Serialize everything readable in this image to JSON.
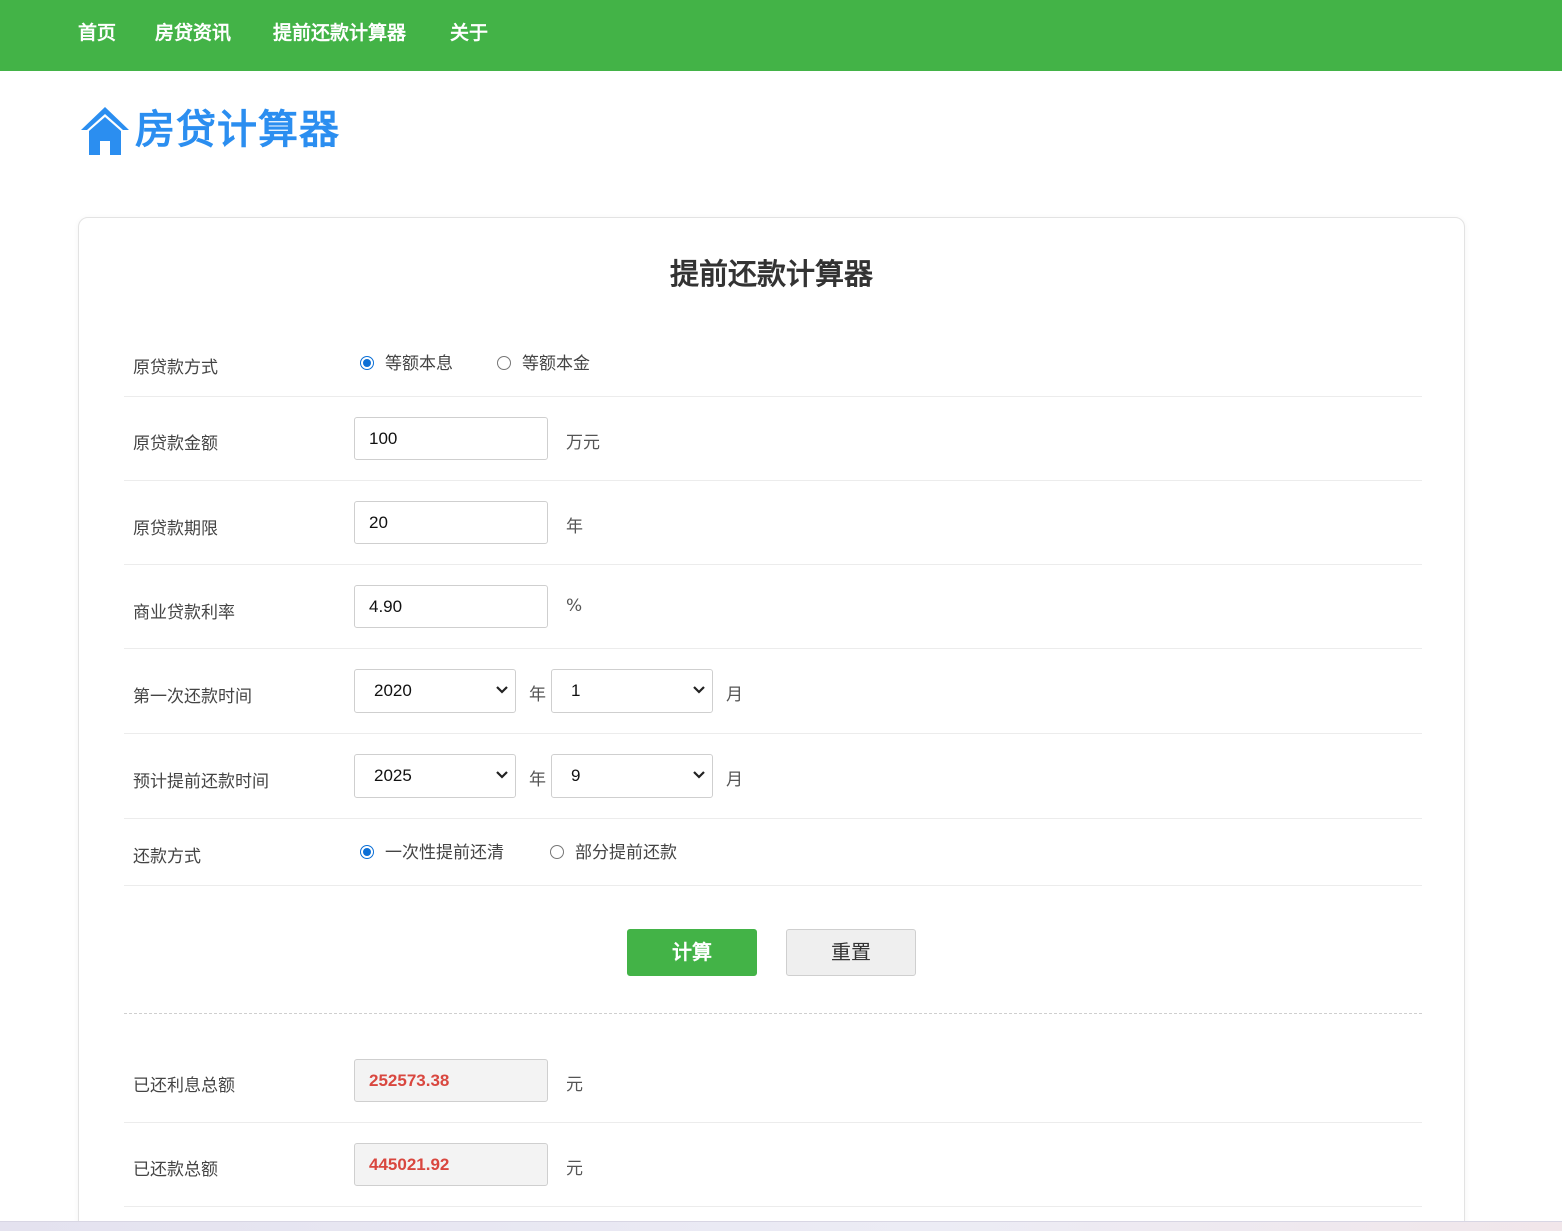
{
  "nav": {
    "items": [
      {
        "label": "首页"
      },
      {
        "label": "房贷资讯"
      },
      {
        "label": "提前还款计算器"
      },
      {
        "label": "关于"
      }
    ]
  },
  "logo": {
    "text": "房贷计算器",
    "icon": "house-icon",
    "color": "#2b8ef0"
  },
  "colors": {
    "nav_bg": "#43b347",
    "accent": "#43b347",
    "result_text": "#d9473f",
    "radio_checked": "#0b6fd6"
  },
  "form": {
    "title": "提前还款计算器",
    "loan_type": {
      "label": "原贷款方式",
      "options": [
        "等额本息",
        "等额本金"
      ],
      "selected": "等额本息"
    },
    "loan_amount": {
      "label": "原贷款金额",
      "value": "100",
      "unit": "万元"
    },
    "loan_term": {
      "label": "原贷款期限",
      "value": "20",
      "unit": "年"
    },
    "interest_rate": {
      "label": "商业贷款利率",
      "value": "4.90",
      "unit": "%"
    },
    "first_payment": {
      "label": "第一次还款时间",
      "year": "2020",
      "year_unit": "年",
      "month": "1",
      "month_unit": "月"
    },
    "prepay_time": {
      "label": "预计提前还款时间",
      "year": "2025",
      "year_unit": "年",
      "month": "9",
      "month_unit": "月"
    },
    "repay_method": {
      "label": "还款方式",
      "options": [
        "一次性提前还清",
        "部分提前还款"
      ],
      "selected": "一次性提前还清"
    },
    "buttons": {
      "calculate": "计算",
      "reset": "重置"
    }
  },
  "results": {
    "interest_paid": {
      "label": "已还利息总额",
      "value": "252573.38",
      "unit": "元"
    },
    "total_paid": {
      "label": "已还款总额",
      "value": "445021.92",
      "unit": "元"
    }
  }
}
